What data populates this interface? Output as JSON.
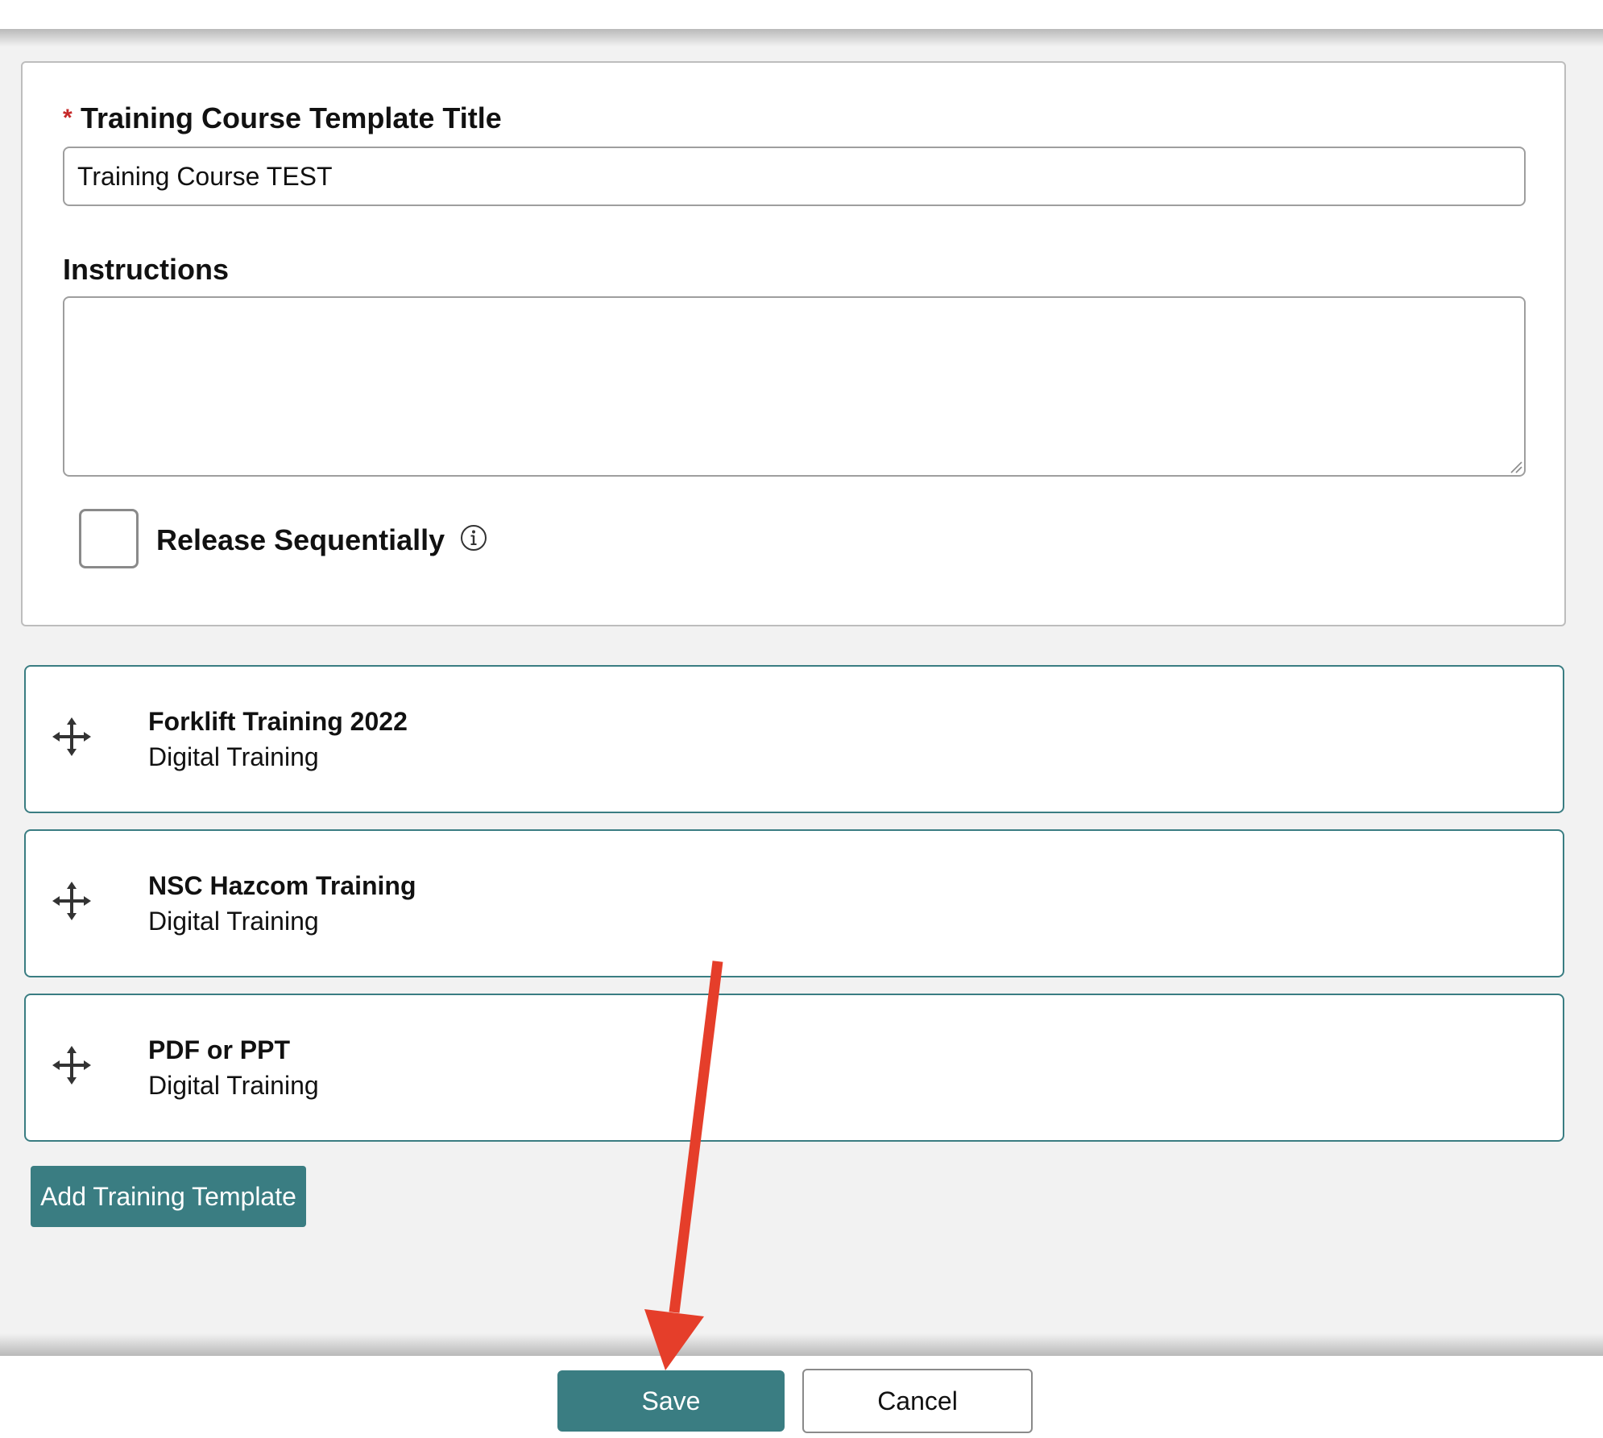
{
  "form": {
    "title_label": "Training Course Template Title",
    "required_marker": "*",
    "title_value": "Training Course TEST",
    "instructions_label": "Instructions",
    "instructions_value": "",
    "release_label": "Release Sequentially",
    "release_checked": false
  },
  "courses": [
    {
      "title": "Forklift Training 2022",
      "type": "Digital Training"
    },
    {
      "title": "NSC Hazcom Training",
      "type": "Digital Training"
    },
    {
      "title": "PDF or PPT",
      "type": "Digital Training"
    }
  ],
  "actions": {
    "add_label": "Add Training Template",
    "save_label": "Save",
    "cancel_label": "Cancel"
  },
  "icons": {
    "drag_handle": "move-icon",
    "info": "info-icon"
  },
  "colors": {
    "accent": "#3a7d82",
    "required": "#c62828",
    "annotation_arrow": "#e53e2a"
  }
}
